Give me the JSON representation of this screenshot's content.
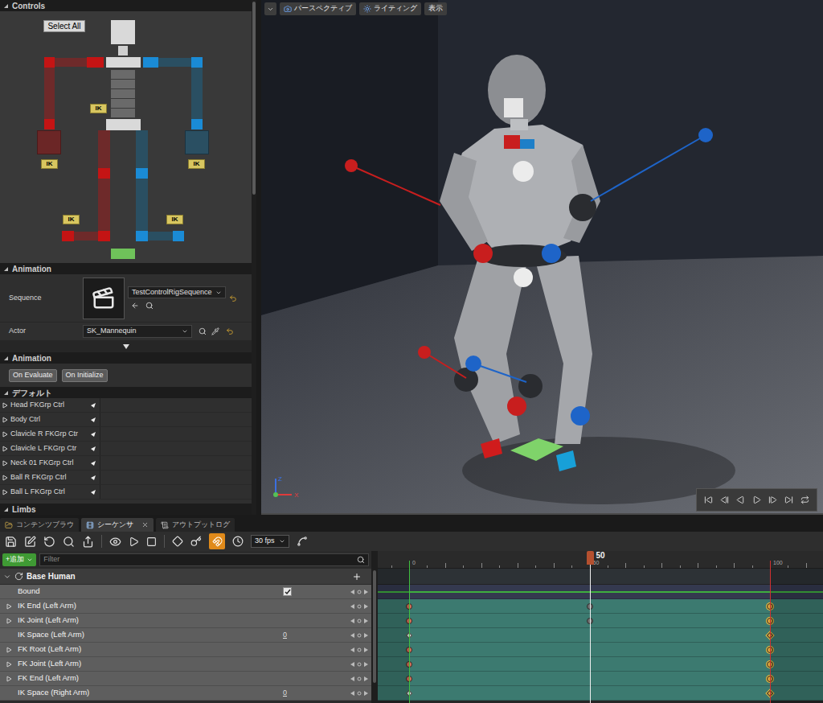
{
  "controls": {
    "title": "Controls",
    "select_all": "Select All",
    "ik_tags": [
      "IK",
      "IK",
      "IK",
      "IK",
      "IK"
    ]
  },
  "animation": {
    "title": "Animation",
    "sequence": {
      "label": "Sequence",
      "value": "TestControlRigSequence"
    },
    "actor": {
      "label": "Actor",
      "value": "SK_Mannequin"
    }
  },
  "animation_events": {
    "title": "Animation",
    "buttons": [
      "On Evaluate",
      "On Initialize"
    ]
  },
  "defaults": {
    "title": "デフォルト",
    "items": [
      "Head FKGrp Ctrl",
      "Body Ctrl",
      "Clavicle R FKGrp Ctr",
      "Clavicle L FKGrp Ctr",
      "Neck 01 FKGrp Ctrl",
      "Ball R FKGrp Ctrl",
      "Ball L FKGrp Ctrl"
    ],
    "next_section": "Limbs"
  },
  "viewport": {
    "buttons": [
      "パースペクティブ",
      "ライティング",
      "表示"
    ],
    "axes": [
      "Z",
      "X"
    ]
  },
  "tabs": [
    {
      "label": "コンテンツブラウ",
      "selected": false
    },
    {
      "label": "シーケンサ",
      "selected": true
    },
    {
      "label": "アウトプットログ",
      "selected": false
    }
  ],
  "sequencer": {
    "fps": "30 fps",
    "add": "+追加",
    "filter_placeholder": "Filter",
    "ruler": [
      "0",
      "50",
      "100"
    ],
    "playhead": {
      "frame": 50,
      "label": "50"
    },
    "range": {
      "start": 0,
      "end": 100
    },
    "tracks": [
      {
        "name": "Base Human",
        "kind": "group",
        "keys": []
      },
      {
        "name": "Bound",
        "kind": "checkbox",
        "checked": true,
        "keys": []
      },
      {
        "name": "IK End (Left Arm)",
        "kind": "track",
        "keys": [
          {
            "frame": 0,
            "color": "#d9735a",
            "selected": false
          },
          {
            "frame": 50,
            "color": "#6d6d6d",
            "selected": false
          },
          {
            "frame": 100,
            "color": "#d9a23a",
            "selected": true
          }
        ]
      },
      {
        "name": "IK Joint (Left Arm)",
        "kind": "track",
        "keys": [
          {
            "frame": 0,
            "color": "#d9735a",
            "selected": false
          },
          {
            "frame": 50,
            "color": "#6d6d6d",
            "selected": false
          },
          {
            "frame": 100,
            "color": "#d9a23a",
            "selected": true
          }
        ]
      },
      {
        "name": "IK Space (Left Arm)",
        "kind": "value",
        "value": "0",
        "keys": [
          {
            "frame": 0,
            "color": "#d8eadf",
            "selected": false
          },
          {
            "frame": 100,
            "color": "#d9a23a",
            "selected": true
          }
        ]
      },
      {
        "name": "FK Root (Left Arm)",
        "kind": "track",
        "keys": [
          {
            "frame": 0,
            "color": "#d9735a",
            "selected": false
          },
          {
            "frame": 100,
            "color": "#d9a23a",
            "selected": true
          }
        ]
      },
      {
        "name": "FK Joint (Left Arm)",
        "kind": "track",
        "keys": [
          {
            "frame": 0,
            "color": "#d9735a",
            "selected": false
          },
          {
            "frame": 100,
            "color": "#d9a23a",
            "selected": true
          }
        ]
      },
      {
        "name": "FK End (Left Arm)",
        "kind": "track",
        "keys": [
          {
            "frame": 0,
            "color": "#d9735a",
            "selected": false
          },
          {
            "frame": 100,
            "color": "#d9a23a",
            "selected": true
          }
        ]
      },
      {
        "name": "IK Space (Right Arm)",
        "kind": "value",
        "value": "0",
        "keys": [
          {
            "frame": 0,
            "color": "#d8eadf",
            "selected": false
          },
          {
            "frame": 100,
            "color": "#d9a23a",
            "selected": true
          }
        ]
      }
    ]
  }
}
